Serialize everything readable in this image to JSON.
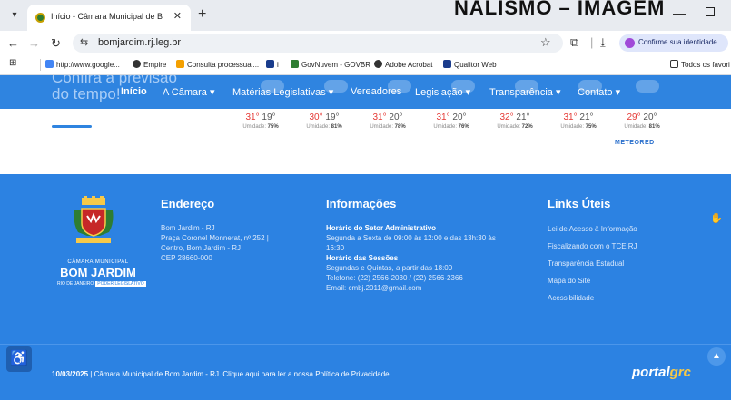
{
  "browser": {
    "tab_title": "Início - Câmara Municipal de B",
    "page_overlay_title": "NALISMO – IMAGEM",
    "url": "bomjardim.rj.leg.br",
    "identity_label": "Confirme sua identidade",
    "bookmarks": [
      {
        "label": "http://www.google...",
        "color": "#4285f4"
      },
      {
        "label": "Empire",
        "color": "#333333"
      },
      {
        "label": "Consulta processual...",
        "color": "#f4a000"
      },
      {
        "label": "i",
        "color": "#1a3c8c"
      },
      {
        "label": "GovNuvem - GOVBR",
        "color": "#2e7d32"
      },
      {
        "label": "Adobe Acrobat",
        "color": "#333333"
      },
      {
        "label": "Qualitor Web",
        "color": "#1a3c8c"
      }
    ],
    "all_bookmarks": "Todos os favori"
  },
  "site": {
    "ghost_title": "Confira a previsão\ndo tempo!",
    "nav": [
      {
        "label": "Início",
        "active": true
      },
      {
        "label": "A Câmara ▾",
        "active": false
      },
      {
        "label": "Matérias Legislativas ▾",
        "active": false
      },
      {
        "label": "Vereadores",
        "active": false
      },
      {
        "label": "Legislação ▾",
        "active": false
      },
      {
        "label": "Transparência ▾",
        "active": false
      },
      {
        "label": "Contato ▾",
        "active": false
      }
    ],
    "weather": [
      {
        "max": "31°",
        "min": "19°",
        "humidity_label": "Umidade:",
        "humidity": "75%"
      },
      {
        "max": "30°",
        "min": "19°",
        "humidity_label": "Umidade:",
        "humidity": "81%"
      },
      {
        "max": "31°",
        "min": "20°",
        "humidity_label": "Umidade:",
        "humidity": "78%"
      },
      {
        "max": "31°",
        "min": "20°",
        "humidity_label": "Umidade:",
        "humidity": "76%"
      },
      {
        "max": "32°",
        "min": "21°",
        "humidity_label": "Umidade:",
        "humidity": "72%"
      },
      {
        "max": "31°",
        "min": "21°",
        "humidity_label": "Umidade:",
        "humidity": "75%"
      },
      {
        "max": "29°",
        "min": "20°",
        "humidity_label": "Umidade:",
        "humidity": "81%"
      }
    ],
    "weather_provider": "METEORED"
  },
  "footer": {
    "brand_small": "CÂMARA MUNICIPAL",
    "brand_big": "BOM JARDIM",
    "brand_sub": "RIO DE JANEIRO",
    "brand_tag": "PODER LEGISLATIVO",
    "address": {
      "title": "Endereço",
      "lines": [
        "Bom Jardim - RJ",
        "Praça Coronel Monnerat, nº 252 |",
        "Centro, Bom Jardim - RJ",
        "CEP 28660-000"
      ]
    },
    "info": {
      "title": "Informações",
      "hours_title": "Horário do Setor Administrativo",
      "hours_line1": "Segunda a Sexta de 09:00 às 12:00 e das 13h:30 às",
      "hours_line2": "16:30",
      "sessions_title": "Horário das Sessões",
      "sessions_line": "Segundas e Quintas, a partir das 18:00",
      "phone": "Telefone: (22) 2566-2030 / (22) 2566-2366",
      "email": "Email: cmbj.2011@gmail.com"
    },
    "links": {
      "title": "Links Úteis",
      "items": [
        "Lei de Acesso à Informação",
        "Fiscalizando com o TCE RJ",
        "Transparência Estadual",
        "Mapa do Site",
        "Acessibilidade"
      ]
    },
    "copyright_date": "10/03/2025",
    "copyright_text": " | Câmara Municipal de Bom Jardim - RJ. Clique aqui para ler a nossa Política de Privacidade",
    "portal_name": "portal",
    "portal_suffix": "grc"
  }
}
